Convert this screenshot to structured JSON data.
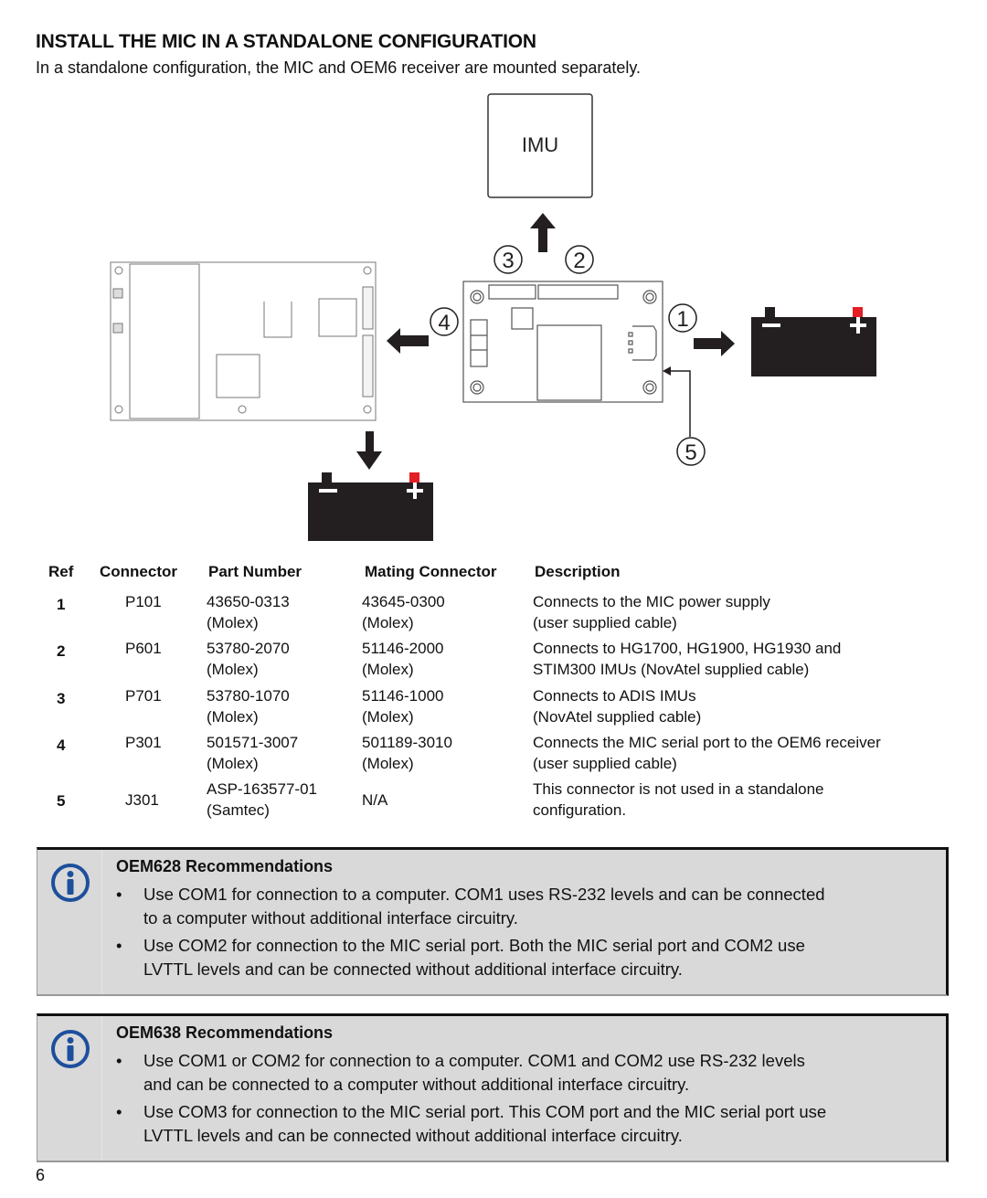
{
  "page": {
    "title": "INSTALL THE MIC IN A STANDALONE CONFIGURATION",
    "intro": "In a standalone configuration, the MIC and OEM6 receiver are mounted separately.",
    "page_number": "6"
  },
  "diagram": {
    "imu_label": "IMU",
    "callouts": [
      "1",
      "2",
      "3",
      "4",
      "5"
    ],
    "colors": {
      "battery": "#231f20",
      "positive_terminal": "#e31e24",
      "arrow": "#231f20"
    }
  },
  "table": {
    "headers": {
      "ref": "Ref",
      "connector": "Connector",
      "part_number": "Part Number",
      "mating_connector": "Mating Connector",
      "description": "Description"
    },
    "rows": [
      {
        "ref": "1",
        "connector": "P101",
        "part_number": [
          "43650-0313",
          "(Molex)"
        ],
        "mating_connector": [
          "43645-0300",
          "(Molex)"
        ],
        "description": [
          "Connects to the MIC power supply",
          "(user supplied cable)"
        ]
      },
      {
        "ref": "2",
        "connector": "P601",
        "part_number": [
          "53780-2070",
          "(Molex)"
        ],
        "mating_connector": [
          "51146-2000",
          "(Molex)"
        ],
        "description": [
          "Connects to HG1700, HG1900, HG1930 and",
          "STIM300 IMUs (NovAtel supplied cable)"
        ]
      },
      {
        "ref": "3",
        "connector": "P701",
        "part_number": [
          "53780-1070",
          "(Molex)"
        ],
        "mating_connector": [
          "51146-1000",
          "(Molex)"
        ],
        "description": [
          "Connects to ADIS IMUs",
          "(NovAtel supplied cable)"
        ]
      },
      {
        "ref": "4",
        "connector": "P301",
        "part_number": [
          "501571-3007",
          "(Molex)"
        ],
        "mating_connector": [
          "501189-3010",
          "(Molex)"
        ],
        "description": [
          "Connects the MIC serial port to the OEM6 receiver",
          "(user supplied cable)"
        ]
      },
      {
        "ref": "5",
        "connector": "J301",
        "part_number": [
          "ASP-163577-01",
          "(Samtec)"
        ],
        "mating_connector": [
          "N/A"
        ],
        "description": [
          "This connector is not used in a standalone",
          "configuration."
        ]
      }
    ]
  },
  "notes": [
    {
      "title": "OEM628 Recommendations",
      "bullets": [
        [
          "Use COM1 for connection to a computer. COM1 uses RS-232 levels and can be connected",
          "to a computer without additional interface circuitry."
        ],
        [
          "Use COM2 for connection to the MIC serial port. Both the MIC serial port and COM2 use",
          "LVTTL levels and can be connected without additional interface circuitry."
        ]
      ]
    },
    {
      "title": "OEM638 Recommendations",
      "bullets": [
        [
          "Use COM1 or COM2 for connection to a computer. COM1 and COM2 use RS-232 levels",
          "and can be connected to a computer without additional interface circuitry."
        ],
        [
          "Use COM3 for connection to the MIC serial port. This COM port and the MIC serial port use",
          "LVTTL levels and can be connected without additional interface circuitry."
        ]
      ]
    }
  ],
  "icons": {
    "info": "info-circle-icon",
    "bullet": "•"
  },
  "colors": {
    "info_icon": "#1d4f9c",
    "note_bg": "#d9d9d9"
  }
}
